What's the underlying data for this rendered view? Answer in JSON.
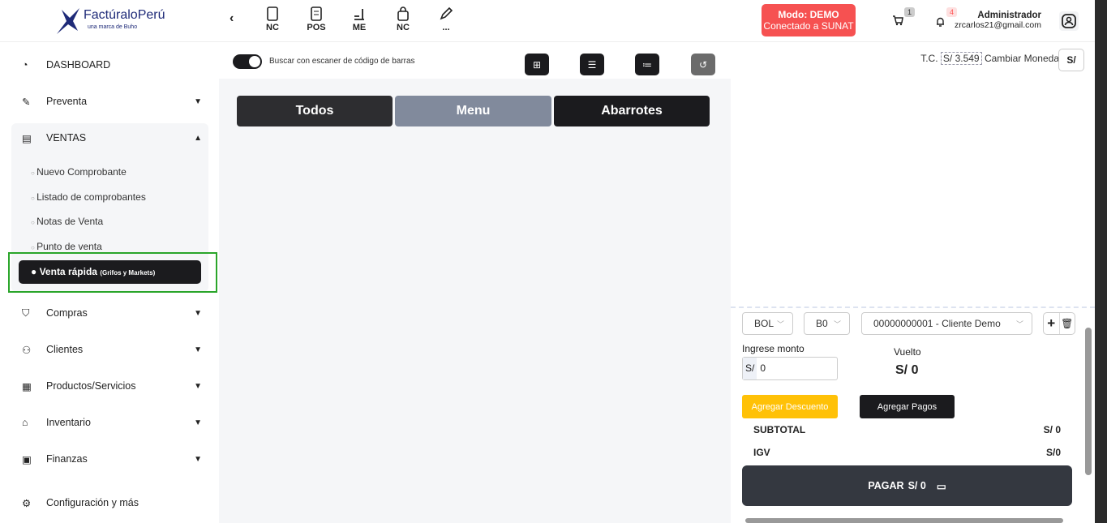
{
  "brand": {
    "name": "FactúraloPerú",
    "tagline": "una marca de Buho"
  },
  "toolbar": {
    "items": [
      {
        "label": "NC",
        "icon": "document-icon"
      },
      {
        "label": "POS",
        "icon": "receipt-icon"
      },
      {
        "label": "ME",
        "icon": "scroll-icon"
      },
      {
        "label": "NC",
        "icon": "bag-icon"
      },
      {
        "label": "...",
        "icon": "edit-icon"
      }
    ]
  },
  "demo": {
    "mode": "Modo: DEMO",
    "status": "Conectado a SUNAT"
  },
  "cart_count": "1",
  "notif_count": "4",
  "user": {
    "name": "Administrador",
    "email": "zrcarlos21@gmail.com"
  },
  "sidebar": {
    "items": [
      {
        "label": "DASHBOARD"
      },
      {
        "label": "Preventa"
      },
      {
        "label": "VENTAS"
      },
      {
        "label": "Compras"
      },
      {
        "label": "Clientes"
      },
      {
        "label": "Productos/Servicios"
      },
      {
        "label": "Inventario"
      },
      {
        "label": "Finanzas"
      },
      {
        "label": "Configuración y más"
      }
    ],
    "ventas_sub": [
      "Nuevo Comprobante",
      "Listado de comprobantes",
      "Notas de Venta",
      "Punto de venta"
    ],
    "active": {
      "label": "Venta rápida",
      "note": "(Grifos y Markets)"
    }
  },
  "main": {
    "scanner_label": "Buscar con escaner de código de barras",
    "categories": [
      "Todos",
      "Menu",
      "Abarrotes"
    ]
  },
  "right": {
    "tc_label": "T.C.",
    "tc_value": "S/ 3.549",
    "change_currency": "Cambiar Moneda",
    "currency": "S/",
    "doc_type": "BOL",
    "series": "B0",
    "client": "00000000001 - Cliente Demo",
    "amount_label": "Ingrese monto",
    "amount_prefix": "S/",
    "amount_value": "0",
    "change_label": "Vuelto",
    "change_value": "S/ 0",
    "discount_btn": "Agregar Descuento",
    "payments_btn": "Agregar Pagos",
    "subtotal_label": "SUBTOTAL",
    "subtotal_value": "S/ 0",
    "igv_label": "IGV",
    "igv_value": "S/0",
    "pay_label": "PAGAR",
    "pay_value": "S/ 0"
  }
}
